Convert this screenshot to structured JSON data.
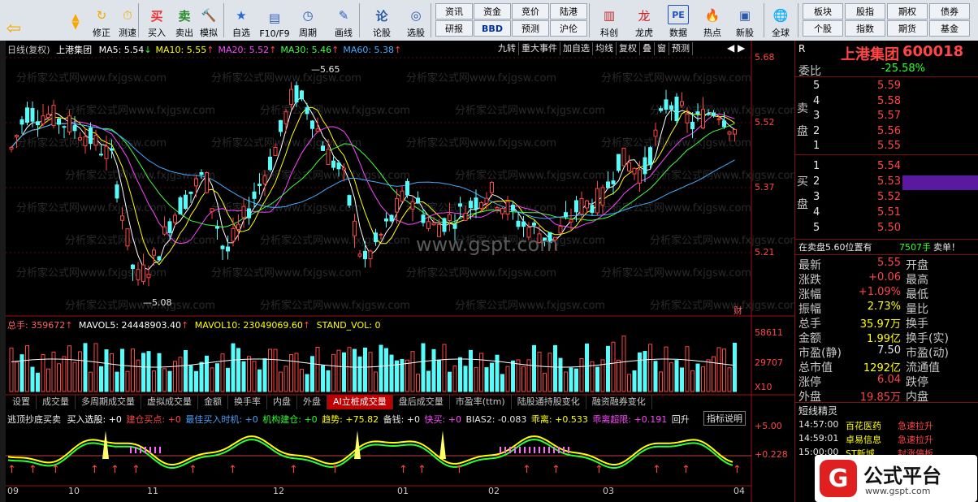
{
  "toolbar": {
    "big": [
      {
        "label": "修正",
        "icon": "refresh-icon"
      },
      {
        "label": "测速",
        "icon": "clock-icon"
      },
      {
        "label": "买入",
        "icon": "buy-icon",
        "glyph": "买"
      },
      {
        "label": "卖出",
        "icon": "sell-icon",
        "glyph": "卖"
      },
      {
        "label": "模拟",
        "icon": "hammer-icon"
      },
      {
        "label": "自选",
        "icon": "star-icon"
      },
      {
        "label": "F10/F9",
        "icon": "f10-icon"
      },
      {
        "label": "周期",
        "icon": "period-icon"
      },
      {
        "label": "画线",
        "icon": "pencil-icon"
      },
      {
        "label": "论股",
        "icon": "discuss-icon",
        "glyph": "论"
      },
      {
        "label": "选股",
        "icon": "pick-icon"
      },
      {
        "label": "科创",
        "icon": "star-market-icon"
      },
      {
        "label": "龙虎",
        "icon": "dragon-tiger-icon"
      },
      {
        "label": "数据",
        "icon": "pe-data-icon",
        "glyph": "PE"
      },
      {
        "label": "热点",
        "icon": "hot-icon"
      },
      {
        "label": "新股",
        "icon": "ipo-icon"
      },
      {
        "label": "全球",
        "icon": "globe-icon"
      }
    ],
    "grid_a": [
      "资讯",
      "资金",
      "竞价",
      "陆港",
      "研报",
      "BBD",
      "预测",
      "沪伦"
    ],
    "grid_b": [
      "板块",
      "股指",
      "期权",
      "债券",
      "个股",
      "指数",
      "期货",
      "基金"
    ]
  },
  "chart": {
    "title_prefix": "日线(复权)",
    "stock_name": "上港集团",
    "ma": [
      {
        "label": "MA5: 5.54",
        "color": "#ffffff"
      },
      {
        "label": "MA10: 5.55",
        "color": "#ffff00"
      },
      {
        "label": "MA20: 5.52",
        "color": "#ff44ff"
      },
      {
        "label": "MA30: 5.46",
        "color": "#44ff44"
      },
      {
        "label": "MA60: 5.38",
        "color": "#44aaff"
      }
    ],
    "top_buttons": [
      "九转",
      "重大事件",
      "加自选",
      "均线",
      "复权",
      "叠",
      "窗",
      "预测"
    ],
    "price_labels": [
      "5.68",
      "5.52",
      "5.37",
      "5.21"
    ],
    "high_marker": "5.65",
    "low_marker": "5.08",
    "watermark": "www.gspt.com",
    "bg_watermark": "分析家公式网www.fxjgsw.com",
    "finance_tag": "财",
    "vol_header": {
      "total": "总手: 359672",
      "mavol5": "MAVOL5: 24448903.40",
      "mavol10": "MAVOL10: 23049069.60",
      "stand": "STAND_VOL: 0"
    },
    "vol_labels": [
      "58611",
      "29707"
    ],
    "vol_unit": "X10",
    "tabs": [
      "设置",
      "成交量",
      "多周期成交量",
      "虚拟成交量",
      "金额",
      "换手率",
      "内盘",
      "外盘",
      "AI立桩成交量",
      "盘后成交量",
      "市盈率(ttm)",
      "陆股通持股变化",
      "融资融券变化"
    ],
    "active_tab": "AI立桩成交量",
    "ind_header": {
      "name": "逃顶抄底买卖",
      "p1": "买入选股: +0",
      "p2": "建仓买点: +0",
      "p3": "最佳买入时机: +0",
      "p4": "机构建仓: +0",
      "p5": "趋势: +75.82",
      "p6": "备钱: +0",
      "p7": "快买: +0",
      "p8": "BIAS2: -0.083",
      "p9": "乖离: +0.533",
      "p10": "乖离超限: +0.191",
      "p11": "回升",
      "btn": "指标说明"
    },
    "ind_labels": [
      "+5.00",
      "+0.228"
    ],
    "months": [
      "09",
      "10",
      "11",
      "12",
      "01",
      "02",
      "03",
      "04"
    ]
  },
  "quote": {
    "r": "R",
    "name": "上港集团",
    "code": "600018",
    "webi_label": "委比",
    "webi_value": "-25.58%",
    "sell_label": "卖盘",
    "buy_label": "买盘",
    "asks": [
      {
        "level": "5",
        "price": "5.59"
      },
      {
        "level": "4",
        "price": "5.58"
      },
      {
        "level": "3",
        "price": "5.57"
      },
      {
        "level": "2",
        "price": "5.56"
      },
      {
        "level": "1",
        "price": "5.55"
      }
    ],
    "bids": [
      {
        "level": "1",
        "price": "5.54"
      },
      {
        "level": "2",
        "price": "5.53"
      },
      {
        "level": "3",
        "price": "5.52"
      },
      {
        "level": "4",
        "price": "5.51"
      },
      {
        "level": "5",
        "price": "5.50"
      }
    ],
    "notice": "在卖盘5.60位置有",
    "notice_qty": "7507手",
    "notice_tail": "卖单！",
    "stats": [
      {
        "l": "最新",
        "v": "5.55",
        "c": "up",
        "r": "开盘"
      },
      {
        "l": "涨跌",
        "v": "+0.06",
        "c": "up",
        "r": "最高"
      },
      {
        "l": "涨幅",
        "v": "+1.09%",
        "c": "up",
        "r": "最低"
      },
      {
        "l": "振幅",
        "v": "2.73%",
        "c": "yellow",
        "r": "量比"
      },
      {
        "l": "总手",
        "v": "35.97万",
        "c": "yellow",
        "r": "换手"
      },
      {
        "l": "金额",
        "v": "1.99亿",
        "c": "yellow",
        "r": "换手(实)"
      },
      {
        "l": "市盈(静)",
        "v": "7.50",
        "c": "white",
        "r": "市盈(动)"
      },
      {
        "l": "总市值",
        "v": "1292亿",
        "c": "yellow",
        "r": "流通值"
      },
      {
        "l": "涨停",
        "v": "6.04",
        "c": "up",
        "r": "跌停"
      },
      {
        "l": "外盘",
        "v": "19.85万",
        "c": "up",
        "r": "内盘"
      }
    ],
    "news_title": "短线精灵",
    "news": [
      {
        "time": "14:57:00",
        "name": "百花医药",
        "event": "急速拉升"
      },
      {
        "time": "14:59:01",
        "name": "卓易信息",
        "event": "急速拉升"
      },
      {
        "time": "15:00:00",
        "name": "ST新城",
        "event": "封涨停板"
      }
    ],
    "brand": "公式平台",
    "brand_url": "www.gspt.com"
  }
}
